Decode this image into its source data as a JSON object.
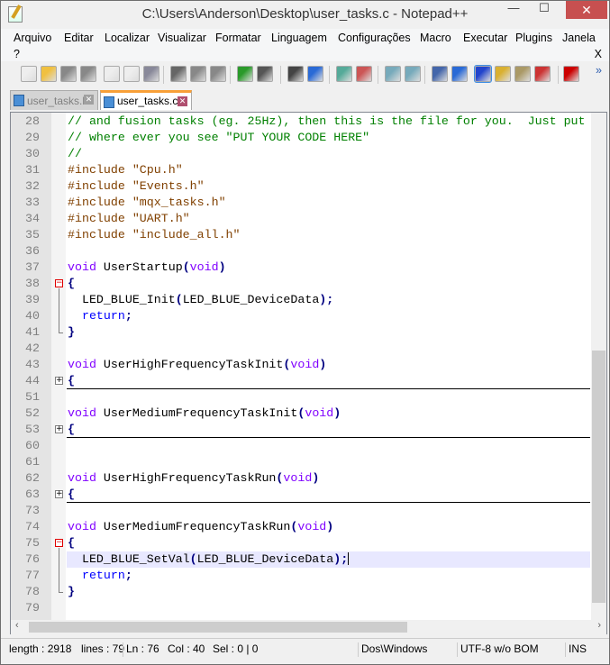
{
  "window": {
    "title": "C:\\Users\\Anderson\\Desktop\\user_tasks.c - Notepad++",
    "minimize": "—",
    "maximize": "☐",
    "close": "✕"
  },
  "menu": [
    "Arquivo",
    "Editar",
    "Localizar",
    "Visualizar",
    "Formatar",
    "Linguagem",
    "Configurações",
    "Macro",
    "Executar",
    "Plugins",
    "Janela",
    "?"
  ],
  "menu_close": "X",
  "toolbar": [
    "new",
    "open",
    "save",
    "save-all",
    "close",
    "close-all",
    "print",
    "cut",
    "copy",
    "paste",
    "undo",
    "redo",
    "find",
    "replace",
    "zoom-in",
    "zoom-out",
    "sync-vertical",
    "sync-horizontal",
    "word-wrap",
    "show-all-chars",
    "indent-guide",
    "user-defined-language",
    "document-map",
    "function-list",
    "record-macro"
  ],
  "toolbar_more": "»",
  "tabs": [
    {
      "label": "user_tasks.h",
      "active": false
    },
    {
      "label": "user_tasks.c",
      "active": true
    }
  ],
  "editor": {
    "current_line": 76,
    "lines": [
      {
        "n": "28",
        "t": [
          [
            "cm",
            "// and fusion tasks (eg. 25Hz), then this is the file for you.  Just put"
          ]
        ]
      },
      {
        "n": "29",
        "t": [
          [
            "cm",
            "// where ever you see \"PUT YOUR CODE HERE\""
          ]
        ]
      },
      {
        "n": "30",
        "t": [
          [
            "cm",
            "//"
          ]
        ]
      },
      {
        "n": "31",
        "t": [
          [
            "pp",
            "#include \"Cpu.h\""
          ]
        ]
      },
      {
        "n": "32",
        "t": [
          [
            "pp",
            "#include \"Events.h\""
          ]
        ]
      },
      {
        "n": "33",
        "t": [
          [
            "pp",
            "#include \"mqx_tasks.h\""
          ]
        ]
      },
      {
        "n": "34",
        "t": [
          [
            "pp",
            "#include \"UART.h\""
          ]
        ]
      },
      {
        "n": "35",
        "t": [
          [
            "pp",
            "#include \"include_all.h\""
          ]
        ]
      },
      {
        "n": "36",
        "t": []
      },
      {
        "n": "37",
        "t": [
          [
            "kw",
            "void"
          ],
          [
            "tx",
            " UserStartup"
          ],
          [
            "op",
            "("
          ],
          [
            "kw",
            "void"
          ],
          [
            "op",
            ")"
          ]
        ]
      },
      {
        "n": "38",
        "fold": "open",
        "t": [
          [
            "op",
            "{"
          ]
        ]
      },
      {
        "n": "39",
        "t": [
          [
            "tx",
            "  LED_BLUE_Init"
          ],
          [
            "op",
            "("
          ],
          [
            "tx",
            "LED_BLUE_DeviceData"
          ],
          [
            "op",
            ");"
          ]
        ]
      },
      {
        "n": "40",
        "t": [
          [
            "tx",
            "  "
          ],
          [
            "rw",
            "return"
          ],
          [
            "op",
            ";"
          ]
        ]
      },
      {
        "n": "41",
        "fold": "end",
        "t": [
          [
            "op",
            "}"
          ]
        ]
      },
      {
        "n": "42",
        "t": []
      },
      {
        "n": "43",
        "t": [
          [
            "kw",
            "void"
          ],
          [
            "tx",
            " UserHighFrequencyTaskInit"
          ],
          [
            "op",
            "("
          ],
          [
            "kw",
            "void"
          ],
          [
            "op",
            ")"
          ]
        ]
      },
      {
        "n": "44",
        "fold": "closed",
        "t": [
          [
            "op",
            "{"
          ]
        ]
      },
      {
        "n": "51",
        "t": []
      },
      {
        "n": "52",
        "t": [
          [
            "kw",
            "void"
          ],
          [
            "tx",
            " UserMediumFrequencyTaskInit"
          ],
          [
            "op",
            "("
          ],
          [
            "kw",
            "void"
          ],
          [
            "op",
            ")"
          ]
        ]
      },
      {
        "n": "53",
        "fold": "closed",
        "t": [
          [
            "op",
            "{"
          ]
        ]
      },
      {
        "n": "60",
        "t": []
      },
      {
        "n": "61",
        "t": []
      },
      {
        "n": "62",
        "t": [
          [
            "kw",
            "void"
          ],
          [
            "tx",
            " UserHighFrequencyTaskRun"
          ],
          [
            "op",
            "("
          ],
          [
            "kw",
            "void"
          ],
          [
            "op",
            ")"
          ]
        ]
      },
      {
        "n": "63",
        "fold": "closed",
        "t": [
          [
            "op",
            "{"
          ]
        ]
      },
      {
        "n": "73",
        "t": []
      },
      {
        "n": "74",
        "t": [
          [
            "kw",
            "void"
          ],
          [
            "tx",
            " UserMediumFrequencyTaskRun"
          ],
          [
            "op",
            "("
          ],
          [
            "kw",
            "void"
          ],
          [
            "op",
            ")"
          ]
        ]
      },
      {
        "n": "75",
        "fold": "open",
        "t": [
          [
            "op",
            "{"
          ]
        ]
      },
      {
        "n": "76",
        "t": [
          [
            "tx",
            "  LED_BLUE_SetVal"
          ],
          [
            "op",
            "("
          ],
          [
            "tx",
            "LED_BLUE_DeviceData"
          ],
          [
            "op",
            ");"
          ]
        ]
      },
      {
        "n": "77",
        "t": [
          [
            "tx",
            "  "
          ],
          [
            "rw",
            "return"
          ],
          [
            "op",
            ";"
          ]
        ]
      },
      {
        "n": "78",
        "fold": "end",
        "t": [
          [
            "op",
            "}"
          ]
        ]
      },
      {
        "n": "79",
        "t": []
      }
    ]
  },
  "status": {
    "length": "length : 2918",
    "lines": "lines : 79",
    "ln": "Ln : 76",
    "col": "Col : 40",
    "sel": "Sel : 0 | 0",
    "eol": "Dos\\Windows",
    "encoding": "UTF-8 w/o BOM",
    "mode": "INS"
  }
}
